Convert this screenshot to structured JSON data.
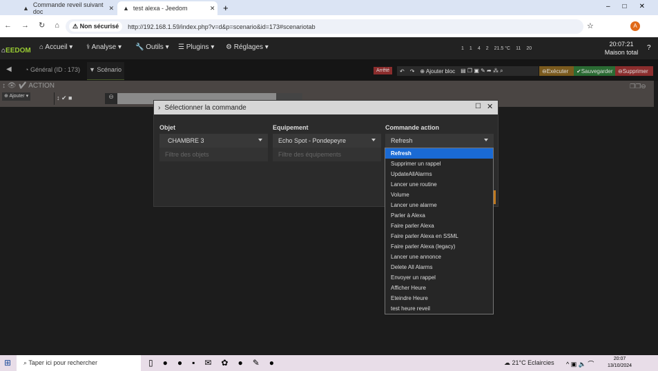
{
  "browser": {
    "tabs": [
      {
        "label": "Commande reveil suivant doc"
      },
      {
        "label": "test alexa - Jeedom"
      }
    ],
    "security": "Non sécurisé",
    "url": "http://192.168.1.59/index.php?v=d&p=scenario&id=173#scenariotab",
    "profile": "A"
  },
  "nav": {
    "logo": "EEDOM",
    "items": [
      "Accueil",
      "Analyse",
      "Outils",
      "Plugins",
      "Réglages"
    ],
    "status": [
      "1",
      "1",
      "4",
      "2",
      "21.5 °C",
      "11",
      "20"
    ],
    "time": "20:07:21",
    "home": "Maison total"
  },
  "sub": {
    "tabs": [
      "Général (ID : 173)",
      "Scénario"
    ],
    "state": "Arrêté",
    "add_block": "Ajouter bloc",
    "execute": "Exécuter",
    "save": "Sauvegarder",
    "delete": "Supprimer",
    "colors": {
      "execute": "#7a5a1e",
      "save": "#2a6b33",
      "delete": "#8b2d2d",
      "state": "#8b2d2d"
    }
  },
  "action": {
    "title": "ACTION",
    "add": "Ajouter"
  },
  "modal": {
    "title": "Sélectionner la commande",
    "cols": [
      {
        "label": "Objet",
        "value": "CHAMBRE 3",
        "filter": "Filtre des objets"
      },
      {
        "label": "Equipement",
        "value": "Echo Spot - Pondepeyre",
        "filter": "Filtre des équipements"
      },
      {
        "label": "Commande action",
        "value": "Refresh"
      }
    ],
    "options": [
      "Refresh",
      "Supprimer un rappel",
      "UpdateAllAlarms",
      "Lancer une routine",
      "Volume",
      "Lancer une alarme",
      "Parler à Alexa",
      "Faire parler Alexa",
      "Faire parler Alexa en SSML",
      "Faire parler Alexa (legacy)",
      "Lancer une annonce",
      "Delete All Alarms",
      "Envoyer un rappel",
      "Afficher Heure",
      "Eteindre Heure",
      "test heure reveil"
    ],
    "selected": "Refresh"
  },
  "taskbar": {
    "search": "Taper ici pour rechercher",
    "weather": "21°C  Eclaircies",
    "time": "20:07",
    "date": "13/10/2024"
  }
}
